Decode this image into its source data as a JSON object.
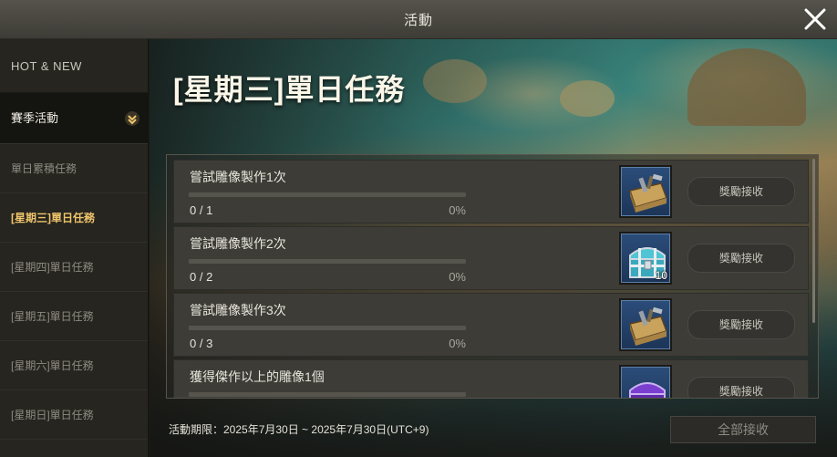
{
  "window": {
    "title": "活動"
  },
  "sidebar": {
    "hot_new": "HOT & NEW",
    "season": "賽季活動",
    "items": [
      {
        "label": "單日累積任務"
      },
      {
        "label": "[星期三]單日任務"
      },
      {
        "label": "[星期四]單日任務"
      },
      {
        "label": "[星期五]單日任務"
      },
      {
        "label": "[星期六]單日任務"
      },
      {
        "label": "[星期日]單日任務"
      }
    ]
  },
  "main": {
    "heading": "[星期三]單日任務",
    "tasks": [
      {
        "name": "嘗試雕像製作1次",
        "count": "0 / 1",
        "percent": "0%",
        "progress": 0,
        "reward_icon": "toolbox-icon",
        "reward_qty": "",
        "claim_label": "獎勵接收"
      },
      {
        "name": "嘗試雕像製作2次",
        "count": "0 / 2",
        "percent": "0%",
        "progress": 0,
        "reward_icon": "treasure-chest-icon",
        "reward_qty": "10",
        "claim_label": "獎勵接收"
      },
      {
        "name": "嘗試雕像製作3次",
        "count": "0 / 3",
        "percent": "0%",
        "progress": 0,
        "reward_icon": "toolbox-icon",
        "reward_qty": "",
        "claim_label": "獎勵接收"
      },
      {
        "name": "獲得傑作以上的雕像1個",
        "count": "",
        "percent": "",
        "progress": 0,
        "reward_icon": "purple-chest-icon",
        "reward_qty": "",
        "claim_label": "獎勵接收"
      }
    ],
    "period": "活動期限：2025年7月30日 ~ 2025年7月30日(UTC+9)",
    "claim_all": "全部接收"
  },
  "colors": {
    "accent_gold": "#f0c56c",
    "reward_bg": "#2b4d7a"
  }
}
